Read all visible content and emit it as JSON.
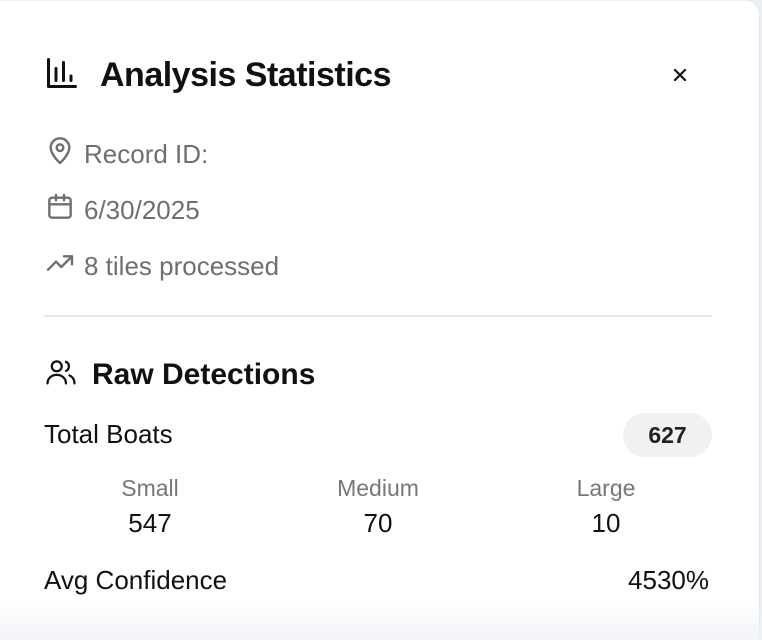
{
  "header": {
    "title": "Analysis Statistics",
    "icon": "bar-chart-icon",
    "close_icon": "close-icon"
  },
  "meta": {
    "record_id_label": "Record ID:",
    "date": "6/30/2025",
    "tiles": "8 tiles processed"
  },
  "raw_detections": {
    "title": "Raw Detections",
    "icon": "users-icon",
    "total_label": "Total Boats",
    "total_value": "627",
    "sizes": [
      {
        "label": "Small",
        "value": "547"
      },
      {
        "label": "Medium",
        "value": "70"
      },
      {
        "label": "Large",
        "value": "10"
      }
    ],
    "confidence_label": "Avg Confidence",
    "confidence_value": "4530%"
  },
  "colors": {
    "text": "#111111",
    "muted": "#6f6f6f",
    "badge_bg": "#f1f1f1",
    "divider": "#e6e6e6"
  }
}
